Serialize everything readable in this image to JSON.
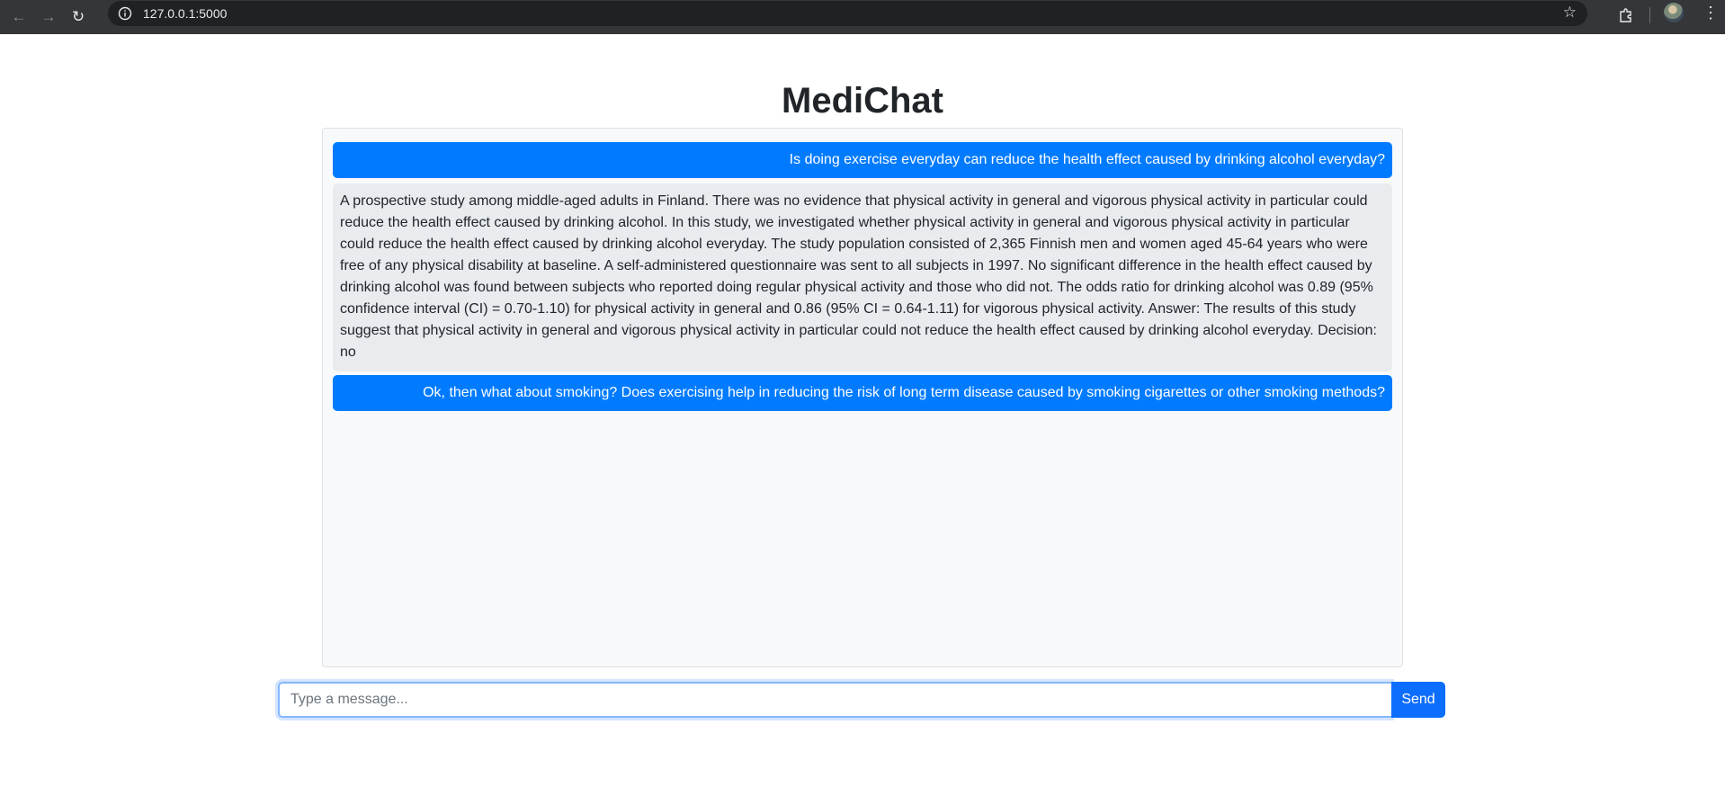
{
  "browser": {
    "url": "127.0.0.1:5000"
  },
  "page": {
    "title": "MediChat"
  },
  "messages": [
    {
      "role": "user",
      "text": "Is doing exercise everyday can reduce the health effect caused by drinking alcohol everyday?"
    },
    {
      "role": "bot",
      "text": "A prospective study among middle-aged adults in Finland. There was no evidence that physical activity in general and vigorous physical activity in particular could reduce the health effect caused by drinking alcohol. In this study, we investigated whether physical activity in general and vigorous physical activity in particular could reduce the health effect caused by drinking alcohol everyday. The study population consisted of 2,365 Finnish men and women aged 45-64 years who were free of any physical disability at baseline. A self-administered questionnaire was sent to all subjects in 1997. No significant difference in the health effect caused by drinking alcohol was found between subjects who reported doing regular physical activity and those who did not. The odds ratio for drinking alcohol was 0.89 (95% confidence interval (CI) = 0.70-1.10) for physical activity in general and 0.86 (95% CI = 0.64-1.11) for vigorous physical activity. Answer: The results of this study suggest that physical activity in general and vigorous physical activity in particular could not reduce the health effect caused by drinking alcohol everyday. Decision: no"
    },
    {
      "role": "user",
      "text": "Ok, then what about smoking? Does exercising help in reducing the risk of long term disease caused by smoking cigarettes or other smoking methods?"
    }
  ],
  "composer": {
    "placeholder": "Type a message...",
    "send_label": "Send"
  },
  "colors": {
    "user_bubble": "#007bff",
    "bot_bubble": "#e9ecef",
    "send_button": "#0d6efd"
  }
}
